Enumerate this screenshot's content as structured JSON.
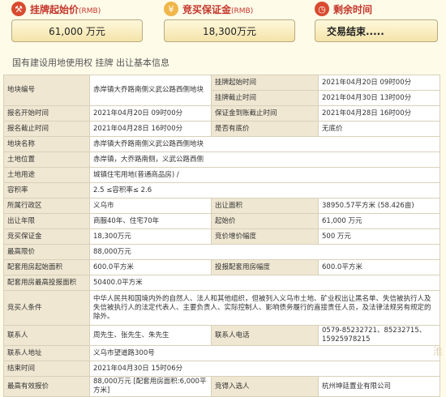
{
  "stats": [
    {
      "title": "挂牌起始价",
      "unit": "(RMB)",
      "value": "61,000 万元",
      "icon": "hammer-icon",
      "color": "#d84b2f"
    },
    {
      "title": "竞买保证金",
      "unit": "(RMB)",
      "value": "18,300万元",
      "icon": "money-icon",
      "color": "#f0b64a"
    },
    {
      "title": "剩余时间",
      "unit": "",
      "value": "交易结束.....",
      "icon": "clock-icon",
      "color": "#d84b2f"
    }
  ],
  "section_title": "国有建设用地使用权 挂牌 出让基本信息",
  "rows": [
    {
      "k1": "地块编号",
      "v1": "赤岸镇大乔路南侧义武公路西侧地块",
      "k2": "挂牌起始时间",
      "v2": "2021年04月20日 09时00分"
    },
    {
      "k1": "",
      "v1": "",
      "k2": "挂牌截止时间",
      "v2": "2021年04月30日 13时00分"
    },
    {
      "k1": "报名开始时间",
      "v1": "2021年04月20日 09时00分",
      "k2": "保证金到账截止时间",
      "v2": "2021年04月28日 16时00分"
    },
    {
      "k1": "报名截止时间",
      "v1": "2021年04月28日 16时00分",
      "k2": "是否有底价",
      "v2": "无底价"
    },
    {
      "k1": "地块名称",
      "v1": "赤岸镇大乔路南侧义武公路西侧地块",
      "k2": "",
      "v2": ""
    },
    {
      "k1": "土地位置",
      "v1": "赤岸镇，大乔路南侧，义武公路西侧",
      "k2": "",
      "v2": ""
    },
    {
      "k1": "土地用途",
      "v1": "城镇住宅用地(普通商品房) /",
      "k2": "",
      "v2": ""
    },
    {
      "k1": "容积率",
      "v1": "2.5 ≤容积率≤ 2.6",
      "k2": "",
      "v2": ""
    },
    {
      "k1": "所属行政区",
      "v1": "义乌市",
      "k2": "出让面积",
      "v2": "38950.57平方米 (58.426亩)"
    },
    {
      "k1": "出让年限",
      "v1": "商服40年、住宅70年",
      "k2": "起始价",
      "v2": "61,000 万元"
    },
    {
      "k1": "竞买保证金",
      "v1": "18,300万元",
      "k2": "竞价增价幅度",
      "v2": "500 万元"
    },
    {
      "k1": "最高限价",
      "v1": "88,000万元",
      "k2": "",
      "v2": ""
    },
    {
      "k1": "配套用房起始面积",
      "v1": "600.0平方米",
      "k2": "投报配套用房幅度",
      "v2": "600.0平方米"
    },
    {
      "k1": "配套用房最高投报面积",
      "v1": "50400.0平方米",
      "k2": "",
      "v2": ""
    },
    {
      "k1": "竞买人条件",
      "v1": "中华人民共和国境内外的自然人、法人和其他组织，但被列入义乌市土地、矿业权出让黑名单、失信被执行人及失信被执行人的法定代表人、主要负责人、实际控制人、影响债务履行的直接责任人员，及法律法规另有规定的除外。",
      "k2": "",
      "v2": ""
    },
    {
      "k1": "联系人",
      "v1": "周先生、张先生、朱先生",
      "k2": "联系人电话",
      "v2": "0579-85232721、85232715、15925978215"
    },
    {
      "k1": "联系人地址",
      "v1": "义乌市望道路300号",
      "k2": "",
      "v2": ""
    },
    {
      "k1": "结束时间",
      "v1": "2021年04月30日 15时06分",
      "k2": "",
      "v2": ""
    },
    {
      "k1": "最高有效报价",
      "v1": "88,000万元 [配套用房面积:6,000平方米]",
      "k2": "竞得入选人",
      "v2": "杭州坤廷置业有限公司"
    }
  ],
  "watermark": "淮"
}
